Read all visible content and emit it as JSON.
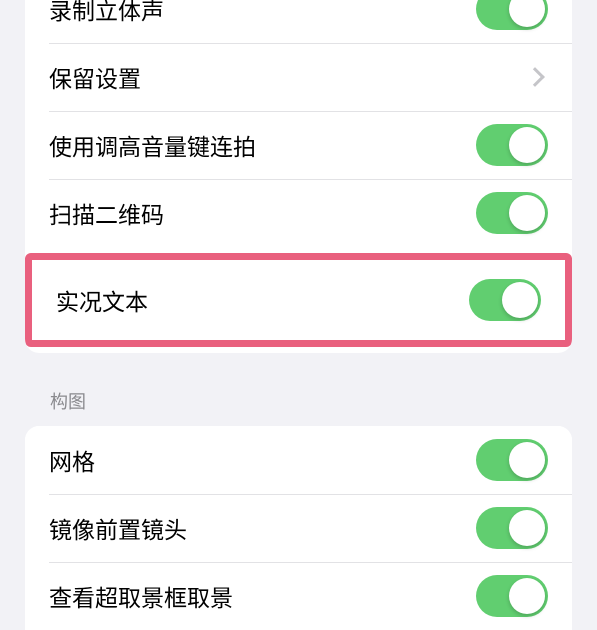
{
  "groups": {
    "top": [
      {
        "label": "录制立体声",
        "type": "toggle",
        "on": true
      },
      {
        "label": "保留设置",
        "type": "nav"
      },
      {
        "label": "使用调高音量键连拍",
        "type": "toggle",
        "on": true
      },
      {
        "label": "扫描二维码",
        "type": "toggle",
        "on": true
      },
      {
        "label": "实况文本",
        "type": "toggle",
        "on": true,
        "highlighted": true
      }
    ],
    "composition_header": "构图",
    "composition": [
      {
        "label": "网格",
        "type": "toggle",
        "on": true
      },
      {
        "label": "镜像前置镜头",
        "type": "toggle",
        "on": true
      },
      {
        "label": "查看超取景框取景",
        "type": "toggle",
        "on": true
      }
    ]
  },
  "colors": {
    "toggle_on": "#61ce70",
    "highlight_border": "#e9607e",
    "background": "#f2f2f6"
  }
}
